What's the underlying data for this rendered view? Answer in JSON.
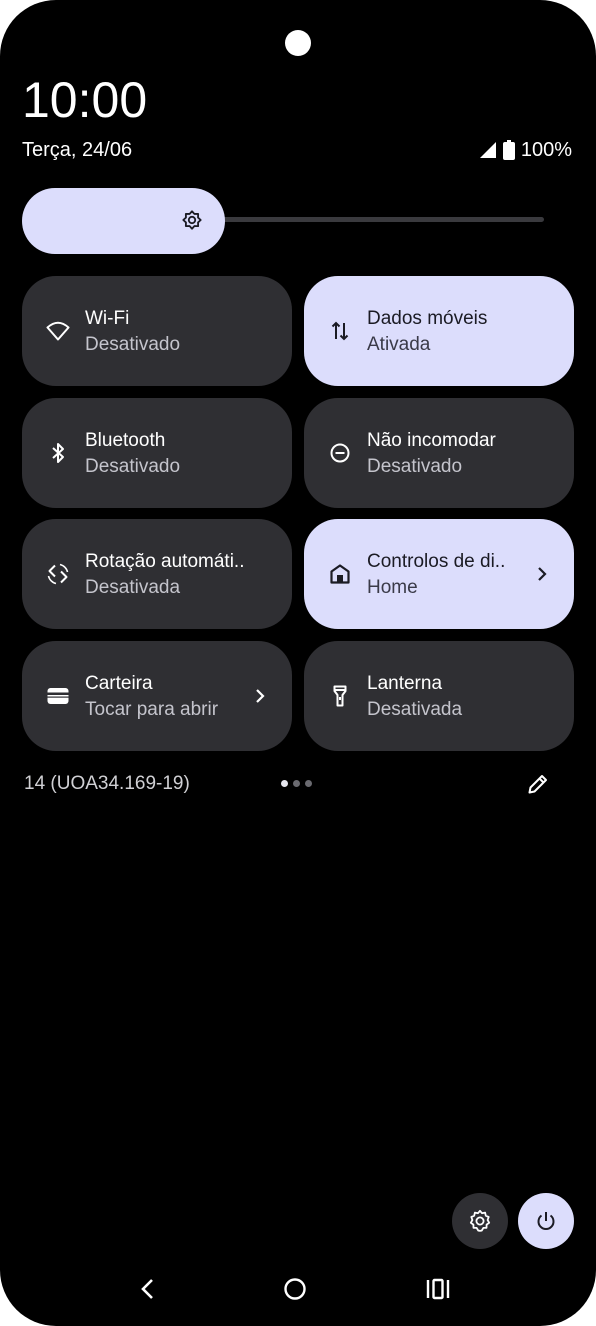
{
  "status_bar": {
    "time": "10:00",
    "date": "Terça, 24/06",
    "battery": "100%"
  },
  "brightness": {
    "level": 0.3
  },
  "tiles": [
    {
      "title": "Wi-Fi",
      "subtitle": "Desativado",
      "active": false,
      "icon": "wifi-icon"
    },
    {
      "title": "Dados móveis",
      "subtitle": "Ativada",
      "active": true,
      "icon": "mobile-data-icon"
    },
    {
      "title": "Bluetooth",
      "subtitle": "Desativado",
      "active": false,
      "icon": "bluetooth-icon"
    },
    {
      "title": "Não incomodar",
      "subtitle": "Desativado",
      "active": false,
      "icon": "do-not-disturb-icon"
    },
    {
      "title": "Rotação automáti..",
      "subtitle": "Desativada",
      "active": false,
      "icon": "auto-rotate-icon"
    },
    {
      "title": "Controlos de di..",
      "subtitle": "Home",
      "active": true,
      "icon": "home-icon"
    },
    {
      "title": "Carteira",
      "subtitle": "Tocar para abrir",
      "active": false,
      "icon": "wallet-icon"
    },
    {
      "title": "Lanterna",
      "subtitle": "Desativada",
      "active": false,
      "icon": "flashlight-icon"
    }
  ],
  "footer": {
    "build": "14 (UOA34.169-19)",
    "page_index": 1,
    "page_count": 3
  },
  "colors": {
    "tile_off": "#2f2f33",
    "tile_on": "#dcddfc",
    "background": "#000000"
  }
}
